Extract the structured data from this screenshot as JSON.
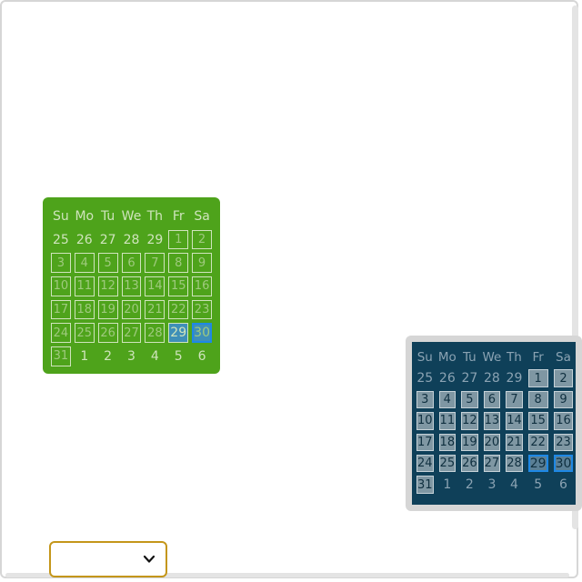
{
  "calendar_green": {
    "weekdays": [
      "Su",
      "Mo",
      "Tu",
      "We",
      "Th",
      "Fr",
      "Sa"
    ],
    "days": [
      {
        "label": "25",
        "state": "other"
      },
      {
        "label": "26",
        "state": "other"
      },
      {
        "label": "27",
        "state": "other"
      },
      {
        "label": "28",
        "state": "other"
      },
      {
        "label": "29",
        "state": "other"
      },
      {
        "label": "1",
        "state": "in"
      },
      {
        "label": "2",
        "state": "in"
      },
      {
        "label": "3",
        "state": "in"
      },
      {
        "label": "4",
        "state": "in"
      },
      {
        "label": "5",
        "state": "in"
      },
      {
        "label": "6",
        "state": "in"
      },
      {
        "label": "7",
        "state": "in"
      },
      {
        "label": "8",
        "state": "in"
      },
      {
        "label": "9",
        "state": "in"
      },
      {
        "label": "10",
        "state": "in"
      },
      {
        "label": "11",
        "state": "in"
      },
      {
        "label": "12",
        "state": "in"
      },
      {
        "label": "13",
        "state": "in"
      },
      {
        "label": "14",
        "state": "in"
      },
      {
        "label": "15",
        "state": "in"
      },
      {
        "label": "16",
        "state": "in"
      },
      {
        "label": "17",
        "state": "in"
      },
      {
        "label": "18",
        "state": "in"
      },
      {
        "label": "19",
        "state": "in"
      },
      {
        "label": "20",
        "state": "in"
      },
      {
        "label": "21",
        "state": "in"
      },
      {
        "label": "22",
        "state": "in"
      },
      {
        "label": "23",
        "state": "in"
      },
      {
        "label": "24",
        "state": "in"
      },
      {
        "label": "25",
        "state": "in"
      },
      {
        "label": "26",
        "state": "in"
      },
      {
        "label": "27",
        "state": "in"
      },
      {
        "label": "28",
        "state": "in"
      },
      {
        "label": "29",
        "state": "sel-today"
      },
      {
        "label": "30",
        "state": "sel"
      },
      {
        "label": "31",
        "state": "in"
      },
      {
        "label": "1",
        "state": "other"
      },
      {
        "label": "2",
        "state": "other"
      },
      {
        "label": "3",
        "state": "other"
      },
      {
        "label": "4",
        "state": "other"
      },
      {
        "label": "5",
        "state": "other"
      },
      {
        "label": "6",
        "state": "other"
      }
    ]
  },
  "calendar_dark": {
    "weekdays": [
      "Su",
      "Mo",
      "Tu",
      "We",
      "Th",
      "Fr",
      "Sa"
    ],
    "days": [
      {
        "label": "25",
        "state": "other"
      },
      {
        "label": "26",
        "state": "other"
      },
      {
        "label": "27",
        "state": "other"
      },
      {
        "label": "28",
        "state": "other"
      },
      {
        "label": "29",
        "state": "other"
      },
      {
        "label": "1",
        "state": "in"
      },
      {
        "label": "2",
        "state": "in"
      },
      {
        "label": "3",
        "state": "in"
      },
      {
        "label": "4",
        "state": "in"
      },
      {
        "label": "5",
        "state": "in"
      },
      {
        "label": "6",
        "state": "in"
      },
      {
        "label": "7",
        "state": "in"
      },
      {
        "label": "8",
        "state": "in"
      },
      {
        "label": "9",
        "state": "in"
      },
      {
        "label": "10",
        "state": "in"
      },
      {
        "label": "11",
        "state": "in"
      },
      {
        "label": "12",
        "state": "in"
      },
      {
        "label": "13",
        "state": "in"
      },
      {
        "label": "14",
        "state": "in"
      },
      {
        "label": "15",
        "state": "in"
      },
      {
        "label": "16",
        "state": "in"
      },
      {
        "label": "17",
        "state": "in"
      },
      {
        "label": "18",
        "state": "in"
      },
      {
        "label": "19",
        "state": "in"
      },
      {
        "label": "20",
        "state": "in"
      },
      {
        "label": "21",
        "state": "in"
      },
      {
        "label": "22",
        "state": "in"
      },
      {
        "label": "23",
        "state": "in"
      },
      {
        "label": "24",
        "state": "in"
      },
      {
        "label": "25",
        "state": "in"
      },
      {
        "label": "26",
        "state": "in"
      },
      {
        "label": "27",
        "state": "in"
      },
      {
        "label": "28",
        "state": "in"
      },
      {
        "label": "29",
        "state": "sel"
      },
      {
        "label": "30",
        "state": "sel"
      },
      {
        "label": "31",
        "state": "in"
      },
      {
        "label": "1",
        "state": "other"
      },
      {
        "label": "2",
        "state": "other"
      },
      {
        "label": "3",
        "state": "other"
      },
      {
        "label": "4",
        "state": "other"
      },
      {
        "label": "5",
        "state": "other"
      },
      {
        "label": "6",
        "state": "other"
      }
    ]
  },
  "dropdown": {
    "value": "",
    "icon": "chevron-down-icon"
  },
  "colors": {
    "green_bg": "#4ea31b",
    "dark_bg": "#0f4059",
    "selection_border": "#1e88e5",
    "dropdown_border": "#c4961a"
  }
}
